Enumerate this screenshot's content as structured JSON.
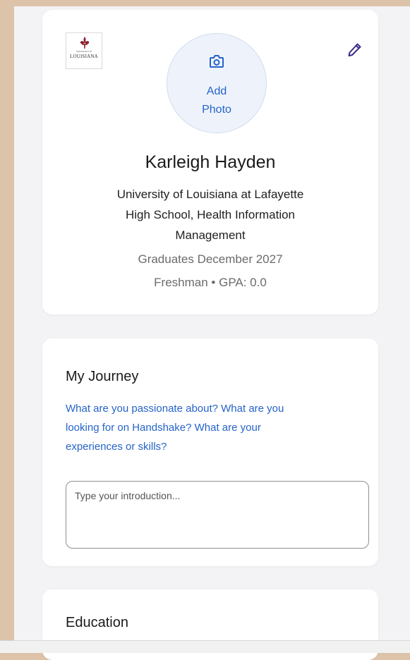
{
  "profile": {
    "logo_small_text": "UNIVERSITY OF",
    "logo_text": "LOUISIANA",
    "add_photo_line1": "Add",
    "add_photo_line2": "Photo",
    "name": "Karleigh Hayden",
    "school": "University of Louisiana at Lafayette",
    "major_line1": "High School, Health Information",
    "major_line2": "Management",
    "graduation": "Graduates December 2027",
    "year_gpa": "Freshman • GPA: 0.0",
    "edit_icon": "pencil-icon",
    "camera_icon": "camera-icon"
  },
  "journey": {
    "title": "My Journey",
    "prompt_line1": "What are you passionate about? What are you",
    "prompt_line2": "looking for on Handshake? What are your",
    "prompt_line3": "experiences or skills?",
    "placeholder": "Type your introduction...",
    "value": ""
  },
  "education": {
    "title": "Education"
  },
  "colors": {
    "accent_blue": "#2563c9",
    "logo_red": "#8b1d2c",
    "edit_purple": "#3b2a8c",
    "page_bg": "#f3f3f5",
    "outer_bg": "#dcc3a9"
  }
}
